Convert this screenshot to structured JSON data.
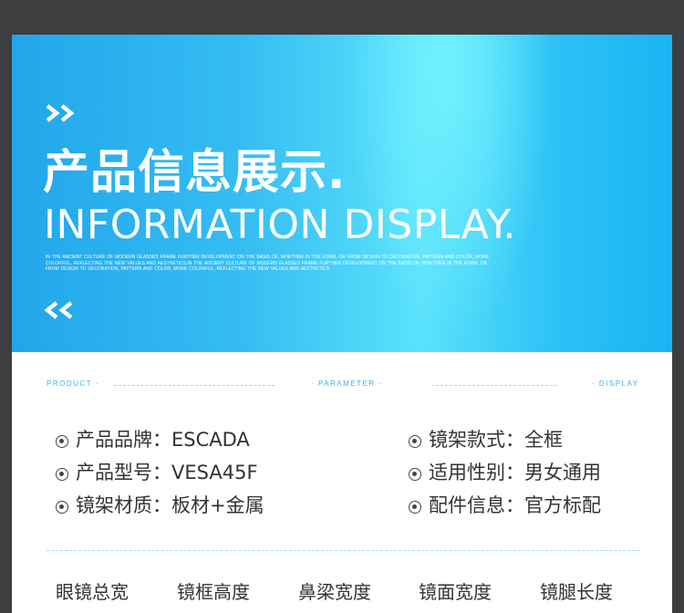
{
  "banner": {
    "title_cn": "产品信息展示.",
    "title_en": "INFORMATION DISPLAY.",
    "description": "IN THE ANCIENT CULTURE OF MODERN GLASSES FRAME FURTHER DEVELOPMENT ON THE BASIS OF, WHETHER IN THE FORM, OR FROM DESIGN TO DECORATION, PATTERN AND COLOR, MORE COLORFUL, REFLECTING THE NEW VALUES AND AESTHETICS.IN THE ANCIENT CULTURE OF MODERN GLASSES FRAME FURTHER DEVELOPMENT ON THE BASIS OF, WHETHER IN THE FORM, OR FROM DESIGN TO DECORATION, PATTERN AND COLOR, MORE COLORFUL, REFLECTING THE NEW VALUES AND AESTHETICS",
    "chevrons_top": "»",
    "chevrons_bottom": "«"
  },
  "nav": {
    "product": "PRODUCT ·",
    "parameter": "· PARAMETER ·",
    "display": "· DISPLAY"
  },
  "specs": [
    {
      "label": "产品品牌：",
      "value": "ESCADA"
    },
    {
      "label": "镜架款式：",
      "value": "全框"
    },
    {
      "label": "产品型号：",
      "value": "VESA45F"
    },
    {
      "label": "适用性别：",
      "value": "男女通用"
    },
    {
      "label": "镜架材质：",
      "value": "板材+金属"
    },
    {
      "label": "配件信息：",
      "value": "官方标配"
    }
  ],
  "measurements": [
    "眼镜总宽",
    "镜框高度",
    "鼻梁宽度",
    "镜面宽度",
    "镜腿长度"
  ],
  "colors": {
    "accent": "#38b4e8",
    "background": "#3d3e40",
    "text": "#333333"
  }
}
